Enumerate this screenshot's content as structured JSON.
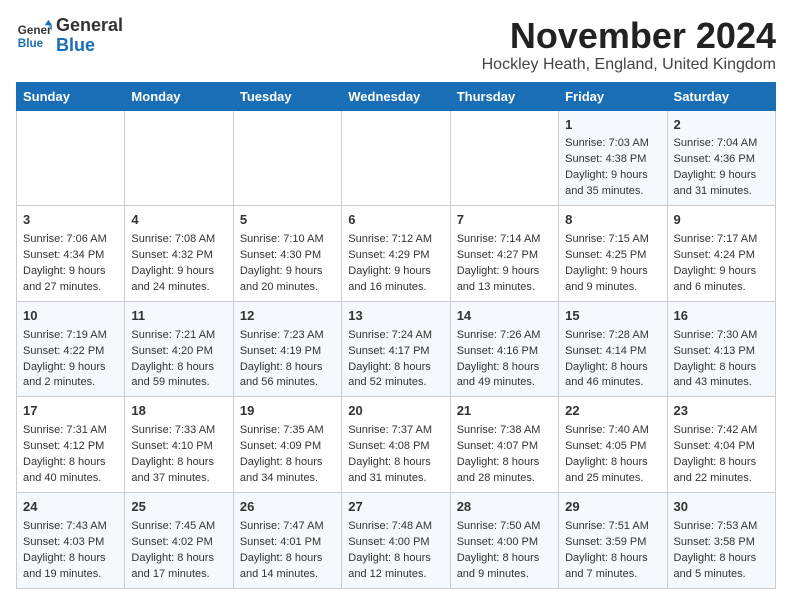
{
  "logo": {
    "general": "General",
    "blue": "Blue"
  },
  "header": {
    "month": "November 2024",
    "location": "Hockley Heath, England, United Kingdom"
  },
  "days_of_week": [
    "Sunday",
    "Monday",
    "Tuesday",
    "Wednesday",
    "Thursday",
    "Friday",
    "Saturday"
  ],
  "weeks": [
    [
      {
        "day": "",
        "info": ""
      },
      {
        "day": "",
        "info": ""
      },
      {
        "day": "",
        "info": ""
      },
      {
        "day": "",
        "info": ""
      },
      {
        "day": "",
        "info": ""
      },
      {
        "day": "1",
        "info": "Sunrise: 7:03 AM\nSunset: 4:38 PM\nDaylight: 9 hours and 35 minutes."
      },
      {
        "day": "2",
        "info": "Sunrise: 7:04 AM\nSunset: 4:36 PM\nDaylight: 9 hours and 31 minutes."
      }
    ],
    [
      {
        "day": "3",
        "info": "Sunrise: 7:06 AM\nSunset: 4:34 PM\nDaylight: 9 hours and 27 minutes."
      },
      {
        "day": "4",
        "info": "Sunrise: 7:08 AM\nSunset: 4:32 PM\nDaylight: 9 hours and 24 minutes."
      },
      {
        "day": "5",
        "info": "Sunrise: 7:10 AM\nSunset: 4:30 PM\nDaylight: 9 hours and 20 minutes."
      },
      {
        "day": "6",
        "info": "Sunrise: 7:12 AM\nSunset: 4:29 PM\nDaylight: 9 hours and 16 minutes."
      },
      {
        "day": "7",
        "info": "Sunrise: 7:14 AM\nSunset: 4:27 PM\nDaylight: 9 hours and 13 minutes."
      },
      {
        "day": "8",
        "info": "Sunrise: 7:15 AM\nSunset: 4:25 PM\nDaylight: 9 hours and 9 minutes."
      },
      {
        "day": "9",
        "info": "Sunrise: 7:17 AM\nSunset: 4:24 PM\nDaylight: 9 hours and 6 minutes."
      }
    ],
    [
      {
        "day": "10",
        "info": "Sunrise: 7:19 AM\nSunset: 4:22 PM\nDaylight: 9 hours and 2 minutes."
      },
      {
        "day": "11",
        "info": "Sunrise: 7:21 AM\nSunset: 4:20 PM\nDaylight: 8 hours and 59 minutes."
      },
      {
        "day": "12",
        "info": "Sunrise: 7:23 AM\nSunset: 4:19 PM\nDaylight: 8 hours and 56 minutes."
      },
      {
        "day": "13",
        "info": "Sunrise: 7:24 AM\nSunset: 4:17 PM\nDaylight: 8 hours and 52 minutes."
      },
      {
        "day": "14",
        "info": "Sunrise: 7:26 AM\nSunset: 4:16 PM\nDaylight: 8 hours and 49 minutes."
      },
      {
        "day": "15",
        "info": "Sunrise: 7:28 AM\nSunset: 4:14 PM\nDaylight: 8 hours and 46 minutes."
      },
      {
        "day": "16",
        "info": "Sunrise: 7:30 AM\nSunset: 4:13 PM\nDaylight: 8 hours and 43 minutes."
      }
    ],
    [
      {
        "day": "17",
        "info": "Sunrise: 7:31 AM\nSunset: 4:12 PM\nDaylight: 8 hours and 40 minutes."
      },
      {
        "day": "18",
        "info": "Sunrise: 7:33 AM\nSunset: 4:10 PM\nDaylight: 8 hours and 37 minutes."
      },
      {
        "day": "19",
        "info": "Sunrise: 7:35 AM\nSunset: 4:09 PM\nDaylight: 8 hours and 34 minutes."
      },
      {
        "day": "20",
        "info": "Sunrise: 7:37 AM\nSunset: 4:08 PM\nDaylight: 8 hours and 31 minutes."
      },
      {
        "day": "21",
        "info": "Sunrise: 7:38 AM\nSunset: 4:07 PM\nDaylight: 8 hours and 28 minutes."
      },
      {
        "day": "22",
        "info": "Sunrise: 7:40 AM\nSunset: 4:05 PM\nDaylight: 8 hours and 25 minutes."
      },
      {
        "day": "23",
        "info": "Sunrise: 7:42 AM\nSunset: 4:04 PM\nDaylight: 8 hours and 22 minutes."
      }
    ],
    [
      {
        "day": "24",
        "info": "Sunrise: 7:43 AM\nSunset: 4:03 PM\nDaylight: 8 hours and 19 minutes."
      },
      {
        "day": "25",
        "info": "Sunrise: 7:45 AM\nSunset: 4:02 PM\nDaylight: 8 hours and 17 minutes."
      },
      {
        "day": "26",
        "info": "Sunrise: 7:47 AM\nSunset: 4:01 PM\nDaylight: 8 hours and 14 minutes."
      },
      {
        "day": "27",
        "info": "Sunrise: 7:48 AM\nSunset: 4:00 PM\nDaylight: 8 hours and 12 minutes."
      },
      {
        "day": "28",
        "info": "Sunrise: 7:50 AM\nSunset: 4:00 PM\nDaylight: 8 hours and 9 minutes."
      },
      {
        "day": "29",
        "info": "Sunrise: 7:51 AM\nSunset: 3:59 PM\nDaylight: 8 hours and 7 minutes."
      },
      {
        "day": "30",
        "info": "Sunrise: 7:53 AM\nSunset: 3:58 PM\nDaylight: 8 hours and 5 minutes."
      }
    ]
  ]
}
